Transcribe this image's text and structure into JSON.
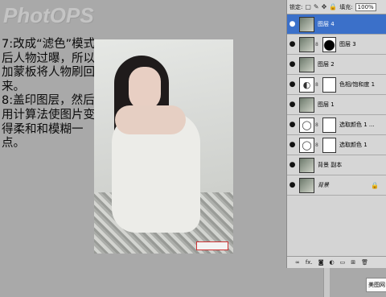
{
  "watermark": "PhotOPS",
  "tutorial_text": "7:改成“滤色”模式后人物过曝，所以加蒙板将人物刷回来。\n8:盖印图层，然后用计算法使图片变得柔和和模糊一点。",
  "layers_panel": {
    "lock_label": "锁定:",
    "fill_label": "填充:",
    "fill_value": "100%",
    "layers": [
      {
        "name": "图层 4",
        "selected": true,
        "thumb": "photo",
        "mask": null
      },
      {
        "name": "图层 3",
        "selected": false,
        "thumb": "photo",
        "mask": "dark"
      },
      {
        "name": "图层 2",
        "selected": false,
        "thumb": "photo",
        "mask": null
      },
      {
        "name": "色相/饱和度 1",
        "selected": false,
        "thumb": "adjust",
        "mask": "white"
      },
      {
        "name": "图层 1",
        "selected": false,
        "thumb": "photo",
        "mask": null
      },
      {
        "name": "选取颜色 1 ...",
        "selected": false,
        "thumb": "adjust",
        "mask": "white"
      },
      {
        "name": "选取颜色 1",
        "selected": false,
        "thumb": "adjust",
        "mask": "white"
      },
      {
        "name": "背景 副本",
        "selected": false,
        "thumb": "photo",
        "mask": null
      },
      {
        "name": "背景",
        "selected": false,
        "thumb": "photo",
        "mask": null,
        "locked": true
      }
    ],
    "bottom_icons": [
      "link-icon",
      "fx-icon",
      "mask-icon",
      "adjustment-icon",
      "group-icon",
      "new-layer-icon",
      "trash-icon"
    ]
  },
  "popup_label": "美图网"
}
